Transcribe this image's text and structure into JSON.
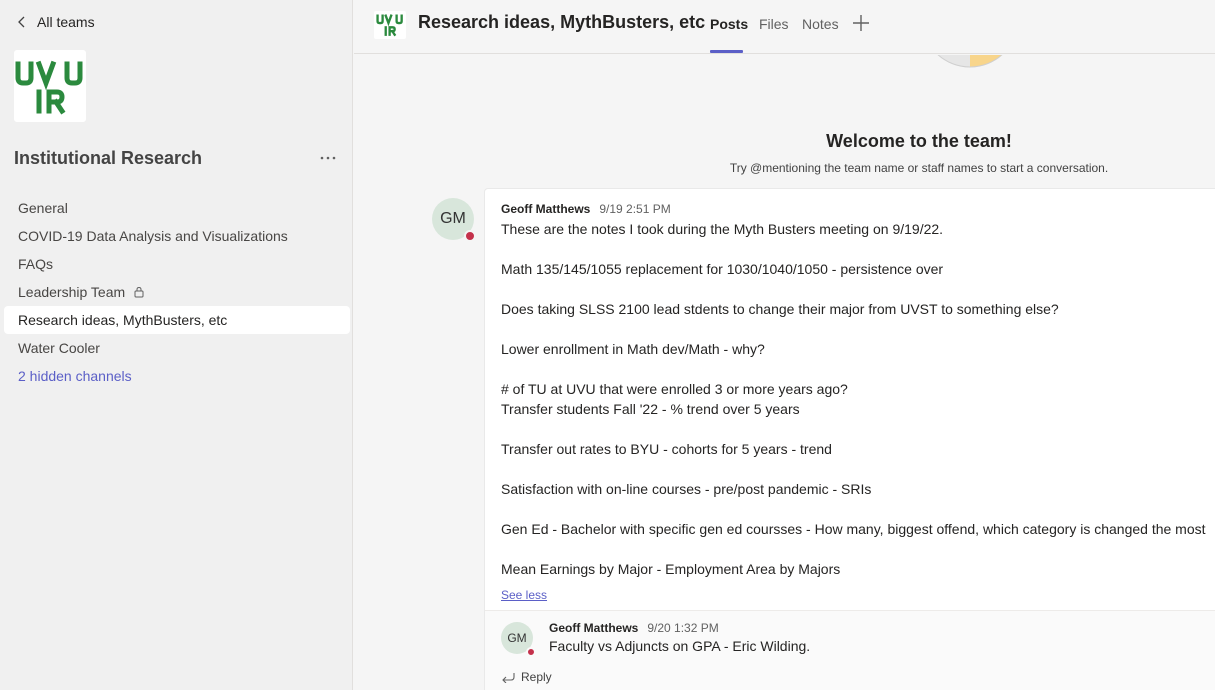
{
  "sidebar": {
    "back_label": "All teams",
    "logo": {
      "line1": "UVU",
      "line2": "IR",
      "color": "#2b8a3e"
    },
    "team_name": "Institutional Research",
    "more_label": "···",
    "channels": [
      {
        "label": "General"
      },
      {
        "label": "COVID-19 Data Analysis and Visualizations"
      },
      {
        "label": "FAQs"
      },
      {
        "label": "Leadership Team",
        "locked": true
      },
      {
        "label": "Research ideas, MythBusters, etc",
        "active": true
      },
      {
        "label": "Water Cooler"
      },
      {
        "label": "2 hidden channels"
      }
    ]
  },
  "header": {
    "logo": {
      "line1": "UVU",
      "line2": "IR"
    },
    "title": "Research ideas, MythBusters, etc",
    "tabs": [
      {
        "label": "Posts",
        "active": true
      },
      {
        "label": "Files"
      },
      {
        "label": "Notes"
      }
    ]
  },
  "welcome": {
    "title": "Welcome to the team!",
    "subtitle": "Try @mentioning the team name or staff names to start a conversation."
  },
  "post": {
    "avatar_initials": "GM",
    "author": "Geoff Matthews",
    "time": "9/19 2:51 PM",
    "lines": [
      "These are the notes I took during the Myth Busters meeting on 9/19/22.",
      "",
      "Math 135/145/1055 replacement for 1030/1040/1050 - persistence over",
      "",
      "Does taking SLSS 2100 lead stdents to change their major from UVST to something else?",
      "",
      "Lower enrollment in Math dev/Math - why?",
      "",
      "# of TU at UVU that were enrolled 3 or more years ago?",
      "Transfer students Fall '22 - % trend over 5 years",
      "",
      "Transfer out rates to BYU - cohorts for 5 years - trend",
      "",
      "Satisfaction with on-line courses - pre/post pandemic - SRIs",
      "",
      "Gen Ed - Bachelor with specific gen ed coursses - How many, biggest offend, which category is changed the most",
      "",
      "Mean Earnings by Major - Employment Area by Majors"
    ],
    "see_less": "See less"
  },
  "reply": {
    "avatar_initials": "GM",
    "author": "Geoff Matthews",
    "time": "9/20 1:32 PM",
    "text": "Faculty vs Adjuncts on GPA - Eric Wilding.",
    "reply_label": "Reply"
  },
  "colors": {
    "accent": "#5b5fc7",
    "status_busy": "#c4314b",
    "logo_green": "#2b8a3e"
  }
}
